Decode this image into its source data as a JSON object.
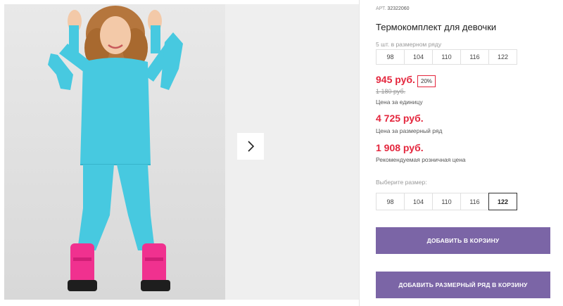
{
  "product": {
    "article_label": "АРТ.",
    "article_number": "32322060",
    "title": "Термокомплект для девочки",
    "size_row_note": "5 шт. в размерном ряду",
    "sizes_row": [
      "98",
      "104",
      "110",
      "116",
      "122"
    ],
    "price": "945 руб.",
    "discount_badge": "20%",
    "old_price": "1 180 руб.",
    "price_caption": "Цена за единицу",
    "row_price": "4 725 руб.",
    "row_price_caption": "Цена за размерный ряд",
    "retail_price": "1 908 руб.",
    "retail_price_caption": "Рекомендуемая розничная цена",
    "choose_size_label": "Выберите размер:",
    "size_options": [
      "98",
      "104",
      "110",
      "116",
      "122"
    ],
    "selected_size": "122",
    "add_to_cart_label": "ДОБАВИТЬ В КОРЗИНУ",
    "add_row_to_cart_label": "ДОБАВИТЬ РАЗМЕРНЫЙ РЯД В КОРЗИНУ"
  },
  "gallery": {
    "next_icon": "chevron-right-icon"
  },
  "colors": {
    "price_red": "#e4263d",
    "button_purple": "#7b65a6",
    "garment_turquoise": "#47c9e0",
    "boots_pink": "#f0318f"
  }
}
